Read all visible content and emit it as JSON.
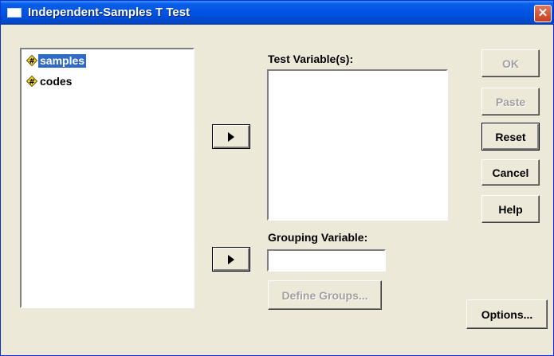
{
  "window": {
    "title": "Independent-Samples T Test",
    "close_glyph": "✕"
  },
  "variables": [
    {
      "label": "samples",
      "icon": "numeric-variable-icon",
      "selected": true
    },
    {
      "label": "codes",
      "icon": "numeric-variable-icon",
      "selected": false
    }
  ],
  "test_variables": {
    "label": "Test Variable(s):",
    "items": []
  },
  "grouping_variable": {
    "label": "Grouping Variable:",
    "value": ""
  },
  "buttons": {
    "ok": "OK",
    "paste": "Paste",
    "reset": "Reset",
    "cancel": "Cancel",
    "help": "Help",
    "define_groups": "Define Groups...",
    "options": "Options..."
  },
  "colors": {
    "titlebar": "#0054e3",
    "selection": "#316ac5",
    "dialog_bg": "#ece9d8"
  }
}
